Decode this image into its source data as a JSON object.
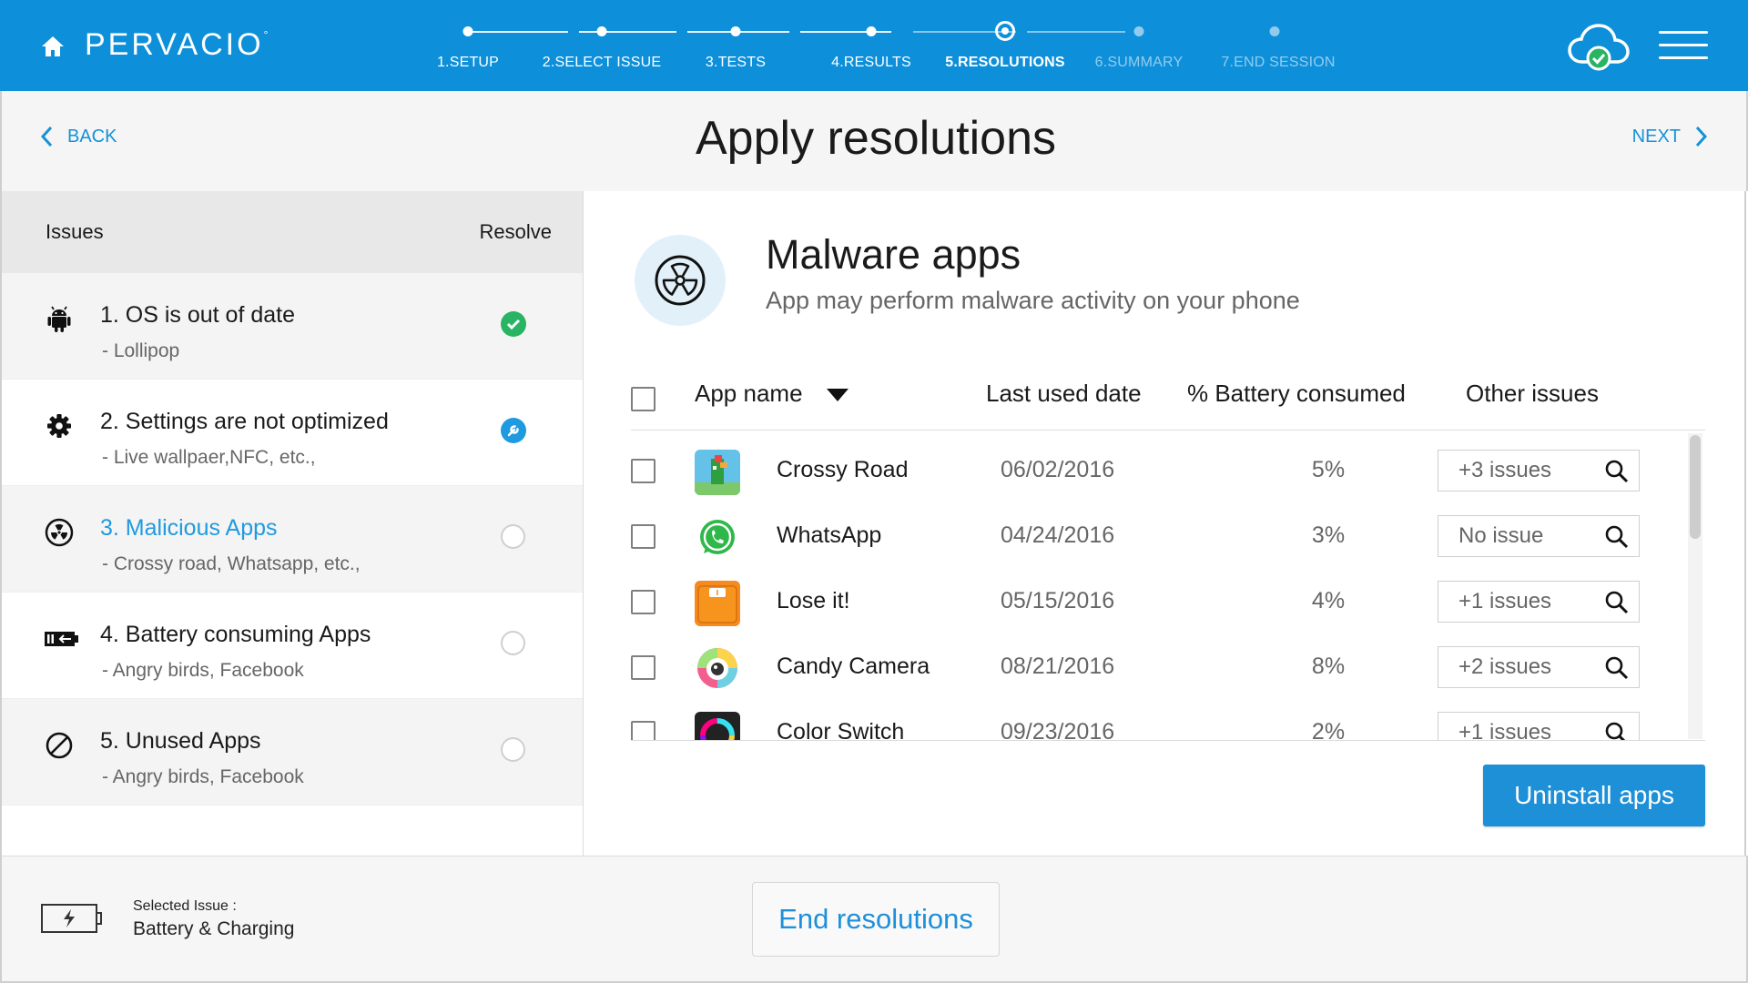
{
  "app": {
    "logo": "PERVACIO",
    "logo_mark": "°"
  },
  "stepper": {
    "steps": [
      {
        "label": "1.SETUP",
        "state": "done"
      },
      {
        "label": "2.SELECT ISSUE",
        "state": "done"
      },
      {
        "label": "3.TESTS",
        "state": "done"
      },
      {
        "label": "4.RESULTS",
        "state": "done"
      },
      {
        "label": "5.RESOLUTIONS",
        "state": "current"
      },
      {
        "label": "6.SUMMARY",
        "state": "upcoming"
      },
      {
        "label": "7.END SESSION",
        "state": "upcoming"
      }
    ]
  },
  "nav": {
    "back": "BACK",
    "next": "NEXT",
    "title": "Apply resolutions"
  },
  "issues_panel": {
    "header_issues": "Issues",
    "header_resolve": "Resolve",
    "items": [
      {
        "icon": "android-icon",
        "title": "1. OS is out of date",
        "sub": "- Lollipop",
        "status": "done"
      },
      {
        "icon": "gear-icon",
        "title": "2. Settings are not optimized",
        "sub": "- Live wallpaer,NFC, etc.,",
        "status": "in-progress"
      },
      {
        "icon": "radiation-icon",
        "title": "3. Malicious Apps",
        "sub": "- Crossy road, Whatsapp, etc.,",
        "status": "pending",
        "active": true
      },
      {
        "icon": "battery-drain-icon",
        "title": "4. Battery consuming Apps",
        "sub": "- Angry birds, Facebook",
        "status": "pending"
      },
      {
        "icon": "prohibited-icon",
        "title": "5. Unused Apps",
        "sub": "- Angry birds, Facebook",
        "status": "pending"
      }
    ]
  },
  "detail": {
    "icon": "radiation-icon",
    "title": "Malware apps",
    "subtitle": "App may perform malware activity on your phone",
    "columns": {
      "name": "App name",
      "date": "Last used date",
      "battery": "% Battery consumed",
      "other": "Other issues"
    },
    "sort_indicator": "sort-desc-icon",
    "apps": [
      {
        "name": "Crossy Road",
        "date": "06/02/2016",
        "battery": "5%",
        "other": "+3 issues",
        "icon": "crossy-road-icon"
      },
      {
        "name": "WhatsApp",
        "date": "04/24/2016",
        "battery": "3%",
        "other": "No issue",
        "icon": "whatsapp-icon"
      },
      {
        "name": "Lose it!",
        "date": "05/15/2016",
        "battery": "4%",
        "other": "+1 issues",
        "icon": "lose-it-icon"
      },
      {
        "name": "Candy Camera",
        "date": "08/21/2016",
        "battery": "8%",
        "other": "+2 issues",
        "icon": "candy-camera-icon"
      },
      {
        "name": "Color Switch",
        "date": "09/23/2016",
        "battery": "2%",
        "other": "+1 issues",
        "icon": "color-switch-icon"
      }
    ],
    "uninstall": "Uninstall apps"
  },
  "footer": {
    "selected_label": "Selected Issue :",
    "selected_value": "Battery & Charging",
    "end": "End resolutions"
  },
  "colors": {
    "brand": "#0d8fd9",
    "accent": "#1e90d8",
    "success": "#28b463"
  }
}
